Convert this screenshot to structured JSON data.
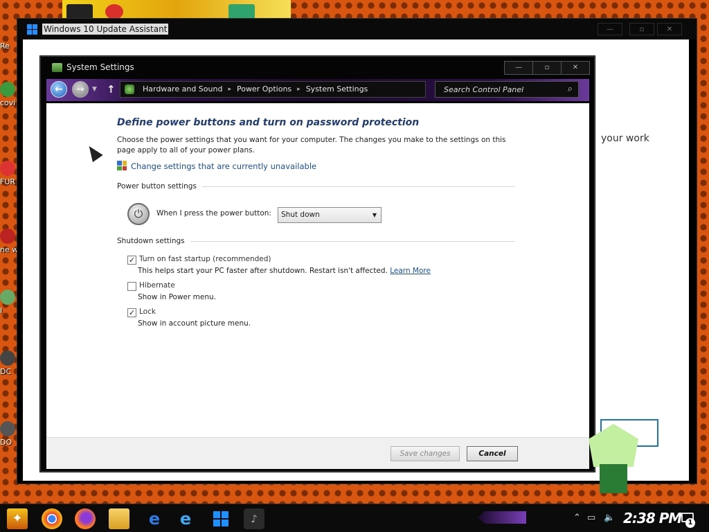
{
  "desktop": {
    "icons": [
      {
        "label": "Re"
      },
      {
        "label": "covi boos"
      },
      {
        "label": "FUR"
      },
      {
        "label": "ne wh"
      },
      {
        "label": "I"
      },
      {
        "label": "DC"
      },
      {
        "label": "DO"
      }
    ]
  },
  "update_assistant": {
    "title": "Windows 10 Update Assistant",
    "body_text": "your work",
    "controls": {
      "minimize": "—",
      "maximize": "▫",
      "close": "✕"
    }
  },
  "control_panel": {
    "title": "System Settings",
    "controls": {
      "minimize": "—",
      "maximize": "▫",
      "close": "✕"
    },
    "breadcrumbs": [
      "Hardware and Sound",
      "Power Options",
      "System Settings"
    ],
    "search_placeholder": "Search Control Panel",
    "heading": "Define power buttons and turn on password protection",
    "description": "Choose the power settings that you want for your computer. The changes you make to the settings on this page apply to all of your power plans.",
    "change_link": "Change settings that are currently unavailable",
    "power_section": {
      "title": "Power button settings",
      "label": "When I press the power button:",
      "selected": "Shut down"
    },
    "shutdown_section": {
      "title": "Shutdown settings",
      "options": [
        {
          "label": "Turn on fast startup (recommended)",
          "checked": true,
          "desc": "This helps start your PC faster after shutdown. Restart isn't affected.",
          "link": "Learn More"
        },
        {
          "label": "Hibernate",
          "checked": false,
          "desc": "Show in Power menu."
        },
        {
          "label": "Lock",
          "checked": true,
          "desc": "Show in account picture menu."
        }
      ]
    },
    "buttons": {
      "save": "Save changes",
      "cancel": "Cancel"
    }
  },
  "taskbar": {
    "clock": "2:38 PM",
    "notification_count": "1",
    "icons": [
      "start-icon",
      "chrome-icon",
      "firefox-icon",
      "file-explorer-icon",
      "edge-icon",
      "internet-explorer-icon",
      "windows-update-icon",
      "steam-icon"
    ]
  }
}
